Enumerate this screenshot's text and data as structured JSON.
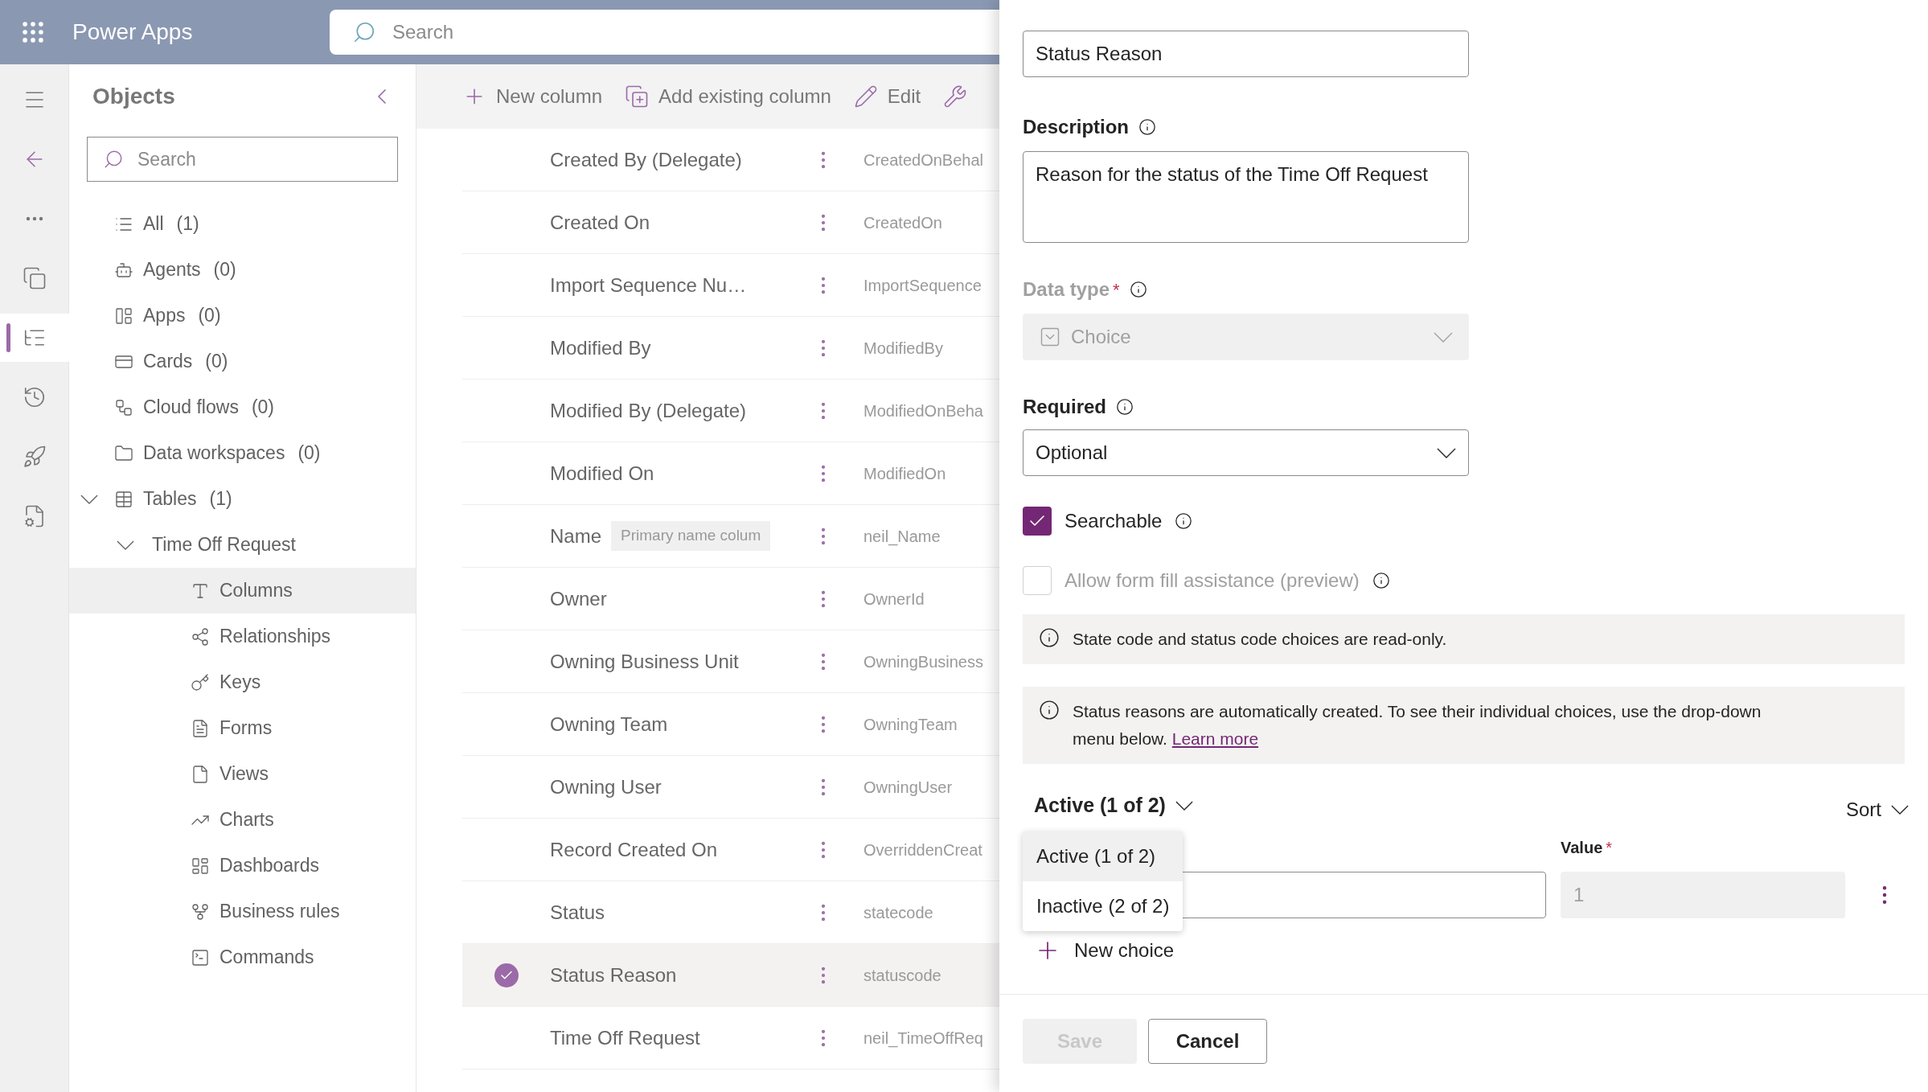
{
  "top_bar": {
    "app_name": "Power Apps",
    "search": {
      "placeholder": "Search"
    }
  },
  "rail": [
    {
      "selected": false
    },
    {
      "selected": false
    },
    {
      "selected": false
    },
    {
      "selected": false
    },
    {
      "selected": true
    },
    {
      "selected": false
    },
    {
      "selected": false
    },
    {
      "selected": false
    }
  ],
  "objects": {
    "title": "Objects",
    "search": {
      "placeholder": "Search"
    },
    "items": [
      {
        "label": "All",
        "count": "(1)",
        "selected": false
      },
      {
        "label": "Agents",
        "count": "(0)",
        "selected": false
      },
      {
        "label": "Apps",
        "count": "(0)",
        "selected": false
      },
      {
        "label": "Cards",
        "count": "(0)",
        "selected": false
      },
      {
        "label": "Cloud flows",
        "count": "(0)",
        "selected": false
      },
      {
        "label": "Data workspaces",
        "count": "(0)",
        "selected": false
      },
      {
        "label": "Tables",
        "count": "(1)",
        "selected": false,
        "expanded": true,
        "children": [
          {
            "label": "Time Off Request",
            "selected": false,
            "expanded": true,
            "children": [
              {
                "label": "Columns",
                "selected": true
              },
              {
                "label": "Relationships",
                "selected": false
              },
              {
                "label": "Keys",
                "selected": false
              },
              {
                "label": "Forms",
                "selected": false
              },
              {
                "label": "Views",
                "selected": false
              },
              {
                "label": "Charts",
                "selected": false
              },
              {
                "label": "Dashboards",
                "selected": false
              },
              {
                "label": "Business rules",
                "selected": false
              },
              {
                "label": "Commands",
                "selected": false
              }
            ]
          }
        ]
      }
    ]
  },
  "toolbar": [
    "New column",
    "Add existing column",
    "Edit"
  ],
  "columns": [
    {
      "name": "Created By (Delegate)",
      "logical": "CreatedOnBehal",
      "selected": false
    },
    {
      "name": "Created On",
      "logical": "CreatedOn",
      "selected": false
    },
    {
      "name": "Import Sequence Nu…",
      "logical": "ImportSequence",
      "selected": false
    },
    {
      "name": "Modified By",
      "logical": "ModifiedBy",
      "selected": false
    },
    {
      "name": "Modified By (Delegate)",
      "logical": "ModifiedOnBeha",
      "selected": false
    },
    {
      "name": "Modified On",
      "logical": "ModifiedOn",
      "selected": false
    },
    {
      "name": "Name",
      "badge": "Primary name colum",
      "logical": "neil_Name",
      "selected": false
    },
    {
      "name": "Owner",
      "logical": "OwnerId",
      "selected": false
    },
    {
      "name": "Owning Business Unit",
      "logical": "OwningBusiness",
      "selected": false
    },
    {
      "name": "Owning Team",
      "logical": "OwningTeam",
      "selected": false
    },
    {
      "name": "Owning User",
      "logical": "OwningUser",
      "selected": false
    },
    {
      "name": "Record Created On",
      "logical": "OverriddenCreat",
      "selected": false
    },
    {
      "name": "Status",
      "logical": "statecode",
      "selected": false
    },
    {
      "name": "Status Reason",
      "logical": "statuscode",
      "selected": true
    },
    {
      "name": "Time Off Request",
      "logical": "neil_TimeOffReq",
      "selected": false
    }
  ],
  "panel": {
    "display_name": {
      "value": "Status Reason"
    },
    "description": {
      "label": "Description",
      "value": "Reason for the status of the Time Off Request"
    },
    "data_type": {
      "label": "Data type",
      "required_mark": "*",
      "value": "Choice",
      "disabled": true
    },
    "required": {
      "label": "Required",
      "value": "Optional"
    },
    "checkboxes": [
      {
        "label": "Searchable",
        "checked": true,
        "disabled": false
      },
      {
        "label": "Allow form fill assistance (preview)",
        "checked": false,
        "disabled": true
      }
    ],
    "notices": [
      {
        "text": "State code and status code choices are read-only."
      },
      {
        "text": "Status reasons are automatically created. To see their individual choices, use the drop-down menu below.",
        "link": "Learn more"
      }
    ],
    "choices": {
      "filter": "Active (1 of 2)",
      "sort": "Sort",
      "menu": [
        {
          "label": "Active (1 of 2)",
          "selected": true
        },
        {
          "label": "Inactive (2 of 2)",
          "selected": false
        }
      ],
      "value_label": "Value",
      "value_required_mark": "*",
      "value": "1",
      "new_choice": "New choice"
    },
    "footer": {
      "save": {
        "label": "Save",
        "disabled": true
      },
      "cancel": "Cancel"
    }
  }
}
